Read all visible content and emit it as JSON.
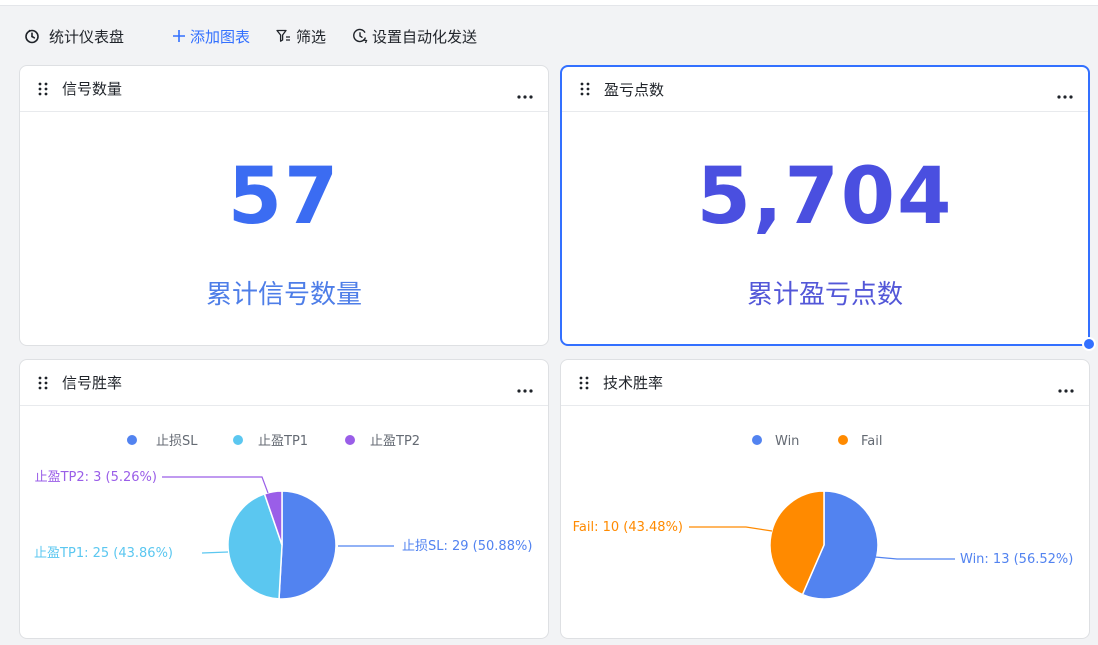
{
  "toolbar": {
    "title": "统计仪表盘",
    "add_chart": "添加图表",
    "filter": "筛选",
    "auto_send": "设置自动化发送"
  },
  "cards": {
    "signal_count": {
      "title": "信号数量",
      "value": "57",
      "label": "累计信号数量",
      "value_color": "#3b6cf2",
      "label_color": "#4e7ee8"
    },
    "pnl_points": {
      "title": "盈亏点数",
      "value": "5,704",
      "label": "累计盈亏点数",
      "value_color": "#4a4fe0",
      "label_color": "#5357d8"
    },
    "signal_winrate": {
      "title": "信号胜率"
    },
    "tech_winrate": {
      "title": "技术胜率"
    }
  },
  "icons": [
    "dashboard-icon",
    "plus-icon",
    "filter-icon",
    "auto-send-icon",
    "drag-handle-icon",
    "more-icon"
  ],
  "chart_data": [
    {
      "type": "pie",
      "title": "信号胜率",
      "legend_position": "top",
      "slices": [
        {
          "name": "止损SL",
          "value": 29,
          "percent": 50.88,
          "color": "#5283f0",
          "label": "止损SL: 29 (50.88%)"
        },
        {
          "name": "止盈TP1",
          "value": 25,
          "percent": 43.86,
          "color": "#5bc7f0",
          "label": "止盈TP1: 25 (43.86%)"
        },
        {
          "name": "止盈TP2",
          "value": 3,
          "percent": 5.26,
          "color": "#9a5ee8",
          "label": "止盈TP2: 3 (5.26%)"
        }
      ]
    },
    {
      "type": "pie",
      "title": "技术胜率",
      "legend_position": "top",
      "slices": [
        {
          "name": "Win",
          "value": 13,
          "percent": 56.52,
          "color": "#5283f0",
          "label": "Win: 13 (56.52%)"
        },
        {
          "name": "Fail",
          "value": 10,
          "percent": 43.48,
          "color": "#ff8a00",
          "label": "Fail: 10 (43.48%)"
        }
      ]
    }
  ]
}
